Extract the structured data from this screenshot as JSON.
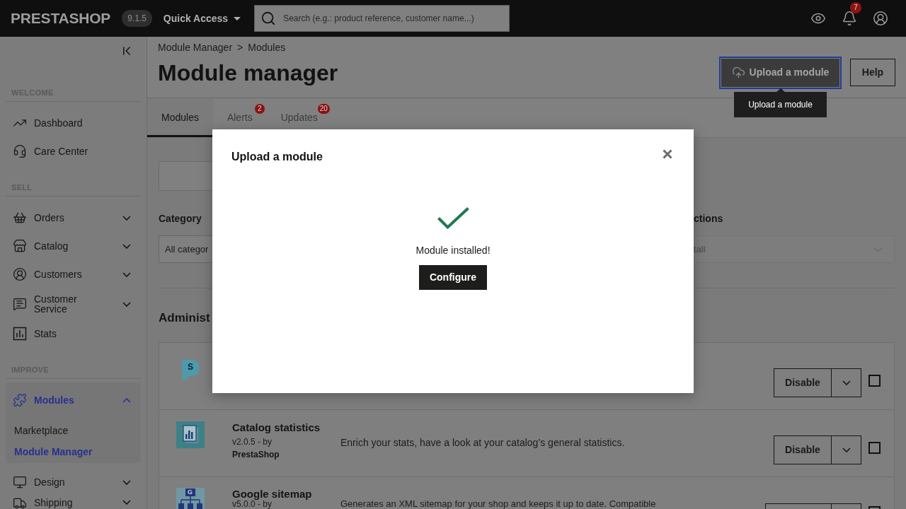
{
  "topbar": {
    "logo": "PRESTASHOP",
    "version": "9.1.5",
    "quick_access": "Quick Access",
    "search": {
      "placeholder": "Search (e.g.: product reference, customer name...)"
    },
    "notifications": "7"
  },
  "sidebar": {
    "sections": [
      {
        "title": "WELCOME",
        "items": [
          {
            "label": "Dashboard",
            "selected": false
          },
          {
            "label": "Care Center",
            "selected": false
          }
        ]
      },
      {
        "title": "SELL",
        "items": [
          {
            "label": "Orders",
            "selected": false,
            "expanded": false
          },
          {
            "label": "Catalog",
            "selected": false,
            "expanded": false
          },
          {
            "label": "Customers",
            "selected": false,
            "expanded": false
          },
          {
            "label": "Customer Service",
            "selected": false,
            "expanded": false
          },
          {
            "label": "Stats",
            "selected": false
          }
        ]
      },
      {
        "title": "IMPROVE",
        "items": [
          {
            "label": "Modules",
            "selected": true,
            "expanded": true,
            "children": [
              {
                "label": "Marketplace",
                "selected": false
              },
              {
                "label": "Module Manager",
                "selected": true
              }
            ]
          },
          {
            "label": "Design",
            "selected": false,
            "expanded": false
          },
          {
            "label": "Shipping",
            "selected": false,
            "expanded": false
          }
        ]
      }
    ]
  },
  "breadcrumb": {
    "items": [
      "Module Manager",
      "Modules"
    ],
    "separator": ">"
  },
  "page_title": "Module manager",
  "header_buttons": [
    {
      "label": "Upload a module",
      "kind": "primary",
      "focused": true
    },
    {
      "label": "Help",
      "kind": "outline",
      "focused": false
    }
  ],
  "tooltip": "Upload a module",
  "tabs": [
    {
      "label": "Modules",
      "selected": true
    },
    {
      "label": "Alerts",
      "selected": false,
      "badge": "2"
    },
    {
      "label": "Updates",
      "selected": false,
      "badge": "20"
    }
  ],
  "filters": [
    {
      "label": "Category",
      "value": "All categor",
      "disabled": false
    },
    {
      "label": "ctions",
      "value": "tall",
      "disabled": true
    }
  ],
  "section_title": "Administ",
  "modules": [
    {
      "logo_letter": "S",
      "action": "Disable",
      "checked": false
    },
    {
      "name": "Catalog statistics",
      "version": "v2.0.5 - by",
      "author": "PrestaShop",
      "description": "Enrich your stats, have a look at your catalog’s general statistics.",
      "action": "Disable",
      "checked": false
    },
    {
      "logo_letter": "G",
      "name": "Google sitemap",
      "version": "v5.0.0 - by",
      "description": "Generates an XML sitemap for your shop and keeps it up to date. Compatible",
      "checked": false
    }
  ],
  "modal": {
    "title": "Upload a module",
    "message": "Module installed!",
    "button": "Configure"
  }
}
